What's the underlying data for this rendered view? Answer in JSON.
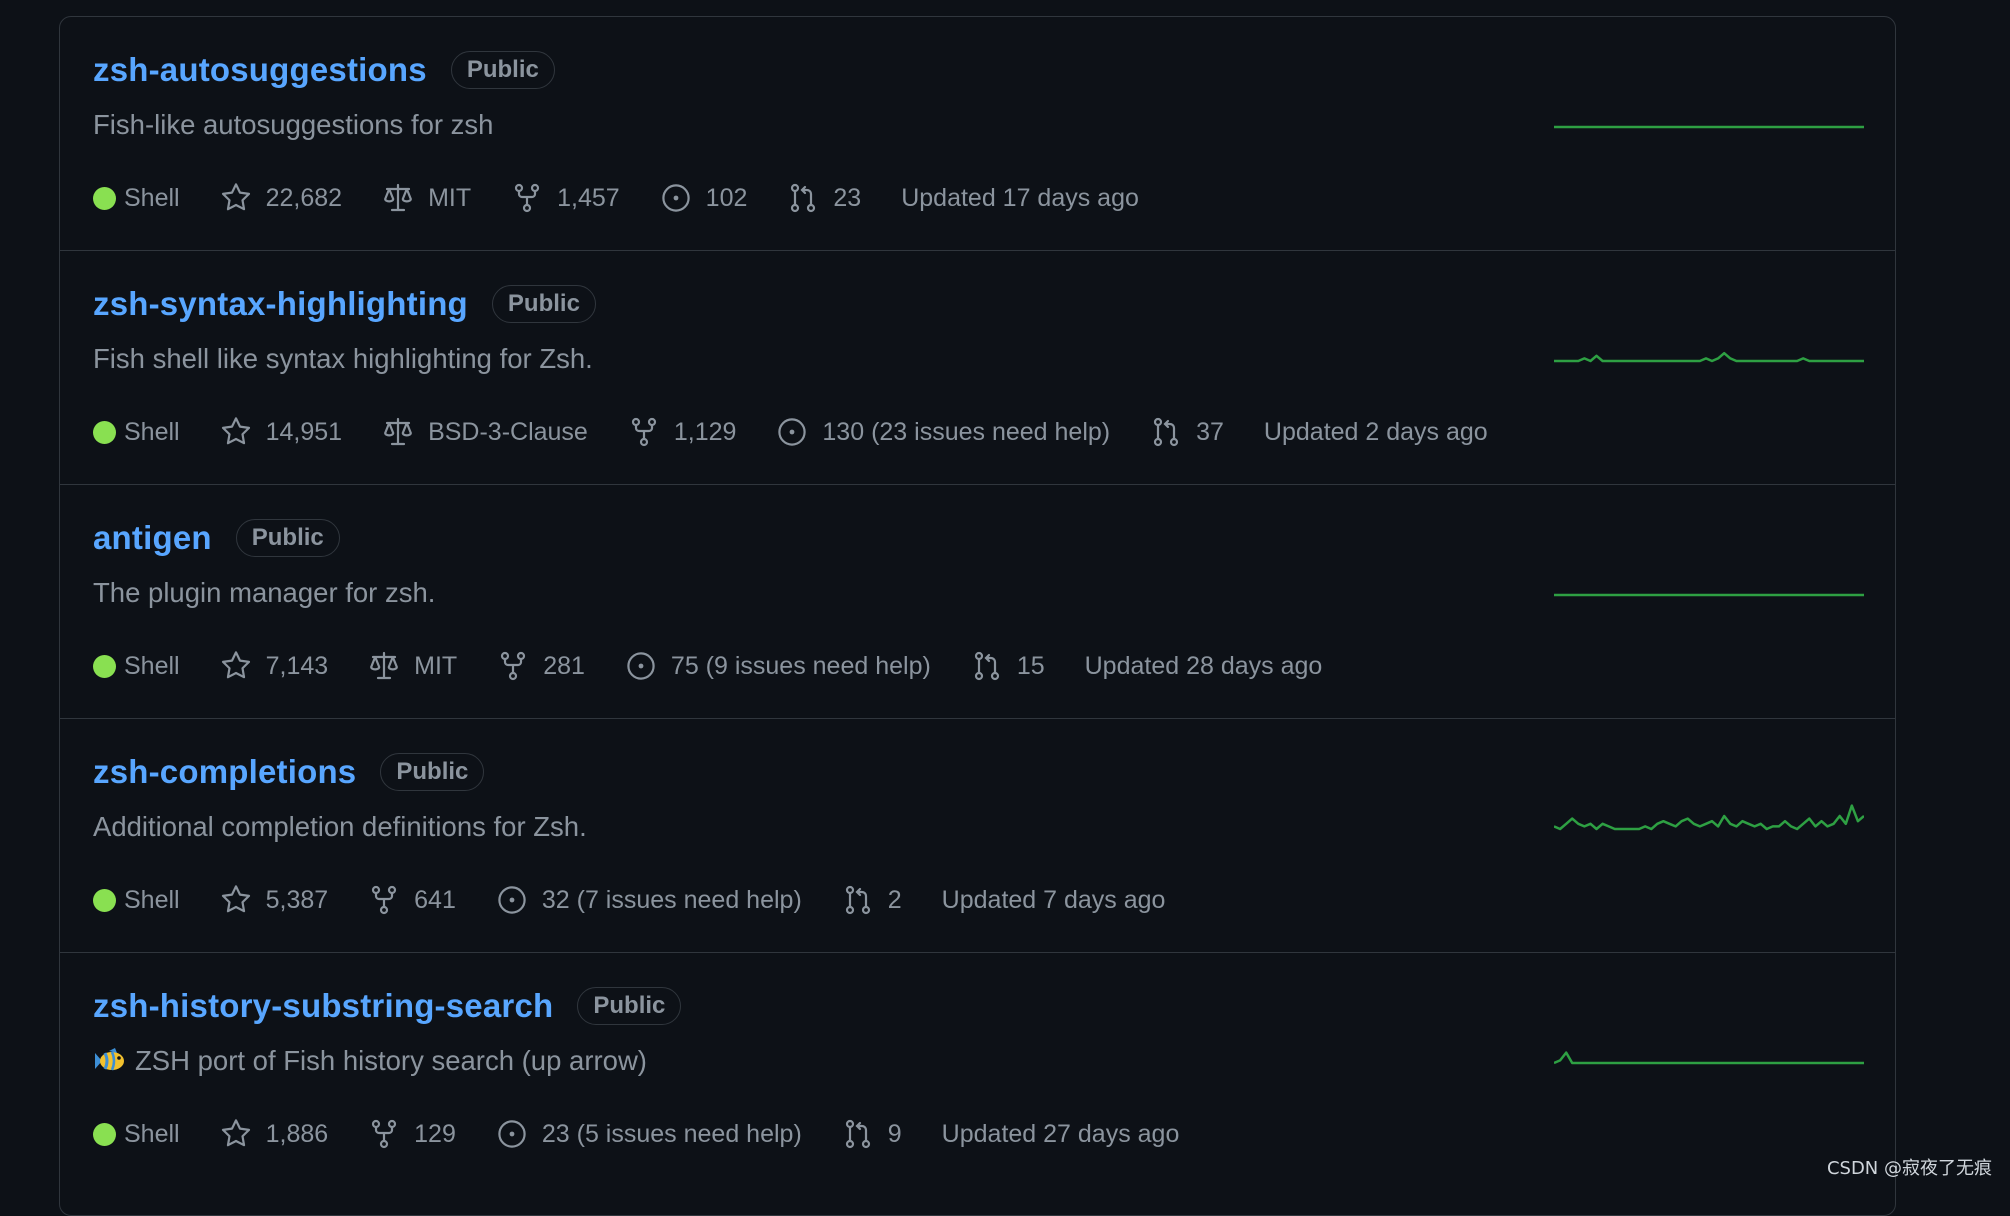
{
  "repos": [
    {
      "name": "zsh-autosuggestions",
      "visibility": "Public",
      "description": "Fish-like autosuggestions for zsh",
      "has_emoji": false,
      "language": "Shell",
      "language_color": "#89e051",
      "stars": "22,682",
      "license": "MIT",
      "forks": "1,457",
      "issues": "102",
      "pull_requests": "23",
      "updated": "Updated 17 days ago",
      "activity": [
        0,
        0,
        0,
        0,
        0,
        0,
        0,
        0,
        0,
        0,
        0,
        0,
        0,
        0,
        0,
        0,
        0,
        0,
        0,
        0,
        0,
        0,
        0,
        0,
        0,
        0,
        0,
        0,
        0,
        0,
        0,
        0,
        0,
        0,
        0,
        0,
        0,
        0,
        0,
        0,
        0,
        0,
        0,
        0,
        0,
        0,
        0,
        0,
        0,
        0,
        0,
        0
      ]
    },
    {
      "name": "zsh-syntax-highlighting",
      "visibility": "Public",
      "description": "Fish shell like syntax highlighting for Zsh.",
      "has_emoji": false,
      "language": "Shell",
      "language_color": "#89e051",
      "stars": "14,951",
      "license": "BSD-3-Clause",
      "forks": "1,129",
      "issues": "130 (23 issues need help)",
      "pull_requests": "37",
      "updated": "Updated 2 days ago",
      "activity": [
        0,
        0,
        0,
        0,
        0,
        1,
        0,
        2,
        0,
        0,
        0,
        0,
        0,
        0,
        0,
        0,
        0,
        0,
        0,
        0,
        0,
        0,
        0,
        0,
        0,
        1,
        0,
        1,
        3,
        1,
        0,
        0,
        0,
        0,
        0,
        0,
        0,
        0,
        0,
        0,
        0,
        1,
        0,
        0,
        0,
        0,
        0,
        0,
        0,
        0,
        0,
        0
      ]
    },
    {
      "name": "antigen",
      "visibility": "Public",
      "description": "The plugin manager for zsh.",
      "has_emoji": false,
      "language": "Shell",
      "language_color": "#89e051",
      "stars": "7,143",
      "license": "MIT",
      "forks": "281",
      "issues": "75 (9 issues need help)",
      "pull_requests": "15",
      "updated": "Updated 28 days ago",
      "activity": [
        0,
        0,
        0,
        0,
        0,
        0,
        0,
        0,
        0,
        0,
        0,
        0,
        0,
        0,
        0,
        0,
        0,
        0,
        0,
        0,
        0,
        0,
        0,
        0,
        0,
        0,
        0,
        0,
        0,
        0,
        0,
        0,
        0,
        0,
        0,
        0,
        0,
        0,
        0,
        0,
        0,
        0,
        0,
        0,
        0,
        0,
        0,
        0,
        0,
        0,
        0,
        0
      ]
    },
    {
      "name": "zsh-completions",
      "visibility": "Public",
      "description": "Additional completion definitions for Zsh.",
      "has_emoji": false,
      "language": "Shell",
      "language_color": "#89e051",
      "stars": "5,387",
      "license": "",
      "forks": "641",
      "issues": "32 (7 issues need help)",
      "pull_requests": "2",
      "updated": "Updated 7 days ago",
      "activity": [
        1,
        0,
        2,
        4,
        2,
        1,
        2,
        0,
        2,
        1,
        0,
        0,
        0,
        0,
        0,
        1,
        0,
        2,
        3,
        2,
        1,
        3,
        4,
        2,
        1,
        2,
        3,
        1,
        5,
        2,
        1,
        3,
        2,
        1,
        2,
        0,
        1,
        1,
        3,
        1,
        0,
        2,
        4,
        1,
        3,
        1,
        2,
        5,
        2,
        9,
        3,
        5
      ]
    },
    {
      "name": "zsh-history-substring-search",
      "visibility": "Public",
      "description": "ZSH port of Fish history search (up arrow)",
      "has_emoji": true,
      "language": "Shell",
      "language_color": "#89e051",
      "stars": "1,886",
      "license": "",
      "forks": "129",
      "issues": "23 (5 issues need help)",
      "pull_requests": "9",
      "updated": "Updated 27 days ago",
      "activity": [
        0,
        1,
        4,
        0,
        0,
        0,
        0,
        0,
        0,
        0,
        0,
        0,
        0,
        0,
        0,
        0,
        0,
        0,
        0,
        0,
        0,
        0,
        0,
        0,
        0,
        0,
        0,
        0,
        0,
        0,
        0,
        0,
        0,
        0,
        0,
        0,
        0,
        0,
        0,
        0,
        0,
        0,
        0,
        0,
        0,
        0,
        0,
        0,
        0,
        0,
        0,
        0
      ]
    }
  ],
  "colors": {
    "link": "#58a6ff",
    "muted": "#8b949e",
    "border": "#30363d",
    "sparkline": "#2ea043",
    "background": "#0d1117"
  },
  "watermark": "CSDN @寂夜了无痕"
}
